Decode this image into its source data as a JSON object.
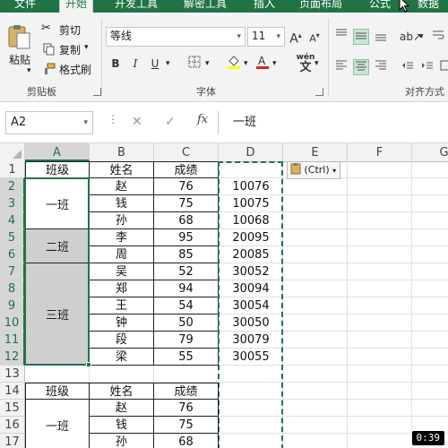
{
  "ribbon": {
    "tabs": [
      "文件",
      "开始",
      "开发工具",
      "解密工具",
      "插入",
      "页面布局",
      "公式",
      "数据"
    ],
    "active_tab": "开始",
    "accent": "#217346",
    "clipboard": {
      "paste": "粘贴",
      "cut": "剪切",
      "copy": "复制",
      "format_painter": "格式刷",
      "group_label": "剪贴板"
    },
    "font": {
      "name": "等线",
      "size": "11",
      "bold": "B",
      "italic": "I",
      "underline": "U",
      "phonetic": "wén",
      "group_label": "字体"
    },
    "alignment": {
      "group_label": "对齐方式"
    }
  },
  "formula_bar": {
    "name_box": "A2",
    "fx": "fx",
    "content": "一班"
  },
  "sheet": {
    "columns": [
      "A",
      "B",
      "C",
      "D",
      "E",
      "F",
      "G"
    ],
    "selected_column": "A",
    "rows": [
      "1",
      "2",
      "3",
      "4",
      "5",
      "6",
      "7",
      "8",
      "9",
      "10",
      "11",
      "12",
      "13",
      "14",
      "15",
      "16",
      "17"
    ],
    "table1": {
      "headers": [
        "班级",
        "姓名",
        "成绩"
      ],
      "classes": [
        "一班",
        "二班",
        "三班"
      ],
      "names": [
        "赵",
        "钱",
        "孙",
        "李",
        "周",
        "吴",
        "郑",
        "王",
        "钟",
        "段",
        "梁"
      ],
      "scores": [
        "76",
        "75",
        "68",
        "95",
        "85",
        "52",
        "94",
        "54",
        "50",
        "79",
        "55"
      ],
      "codes": [
        "10076",
        "10075",
        "10068",
        "20095",
        "20085",
        "30052",
        "30094",
        "30054",
        "30050",
        "30079",
        "30055"
      ]
    },
    "table2": {
      "headers": [
        "班级",
        "姓名",
        "成绩"
      ],
      "classes": [
        "一班"
      ],
      "names": [
        "赵",
        "钱",
        "孙"
      ],
      "scores": [
        "76",
        "75",
        "68"
      ]
    },
    "paste_options": "(Ctrl)"
  },
  "video_timer": "0:39"
}
